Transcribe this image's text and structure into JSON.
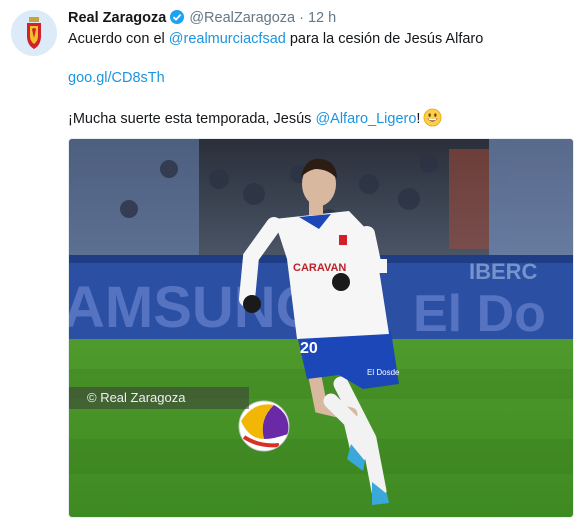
{
  "tweet": {
    "name": "Real Zaragoza",
    "handle": "@RealZaragoza",
    "separator": "·",
    "time": "12 h",
    "line1_prefix": "Acuerdo con el ",
    "line1_mention": "@realmurciacfsad",
    "line1_suffix": " para la cesión de Jesús Alfaro",
    "short_link": "goo.gl/CD8sTh",
    "line3_prefix": "¡Mucha suerte esta temporada, Jesús ",
    "line3_mention": "@Alfaro_Ligero",
    "line3_suffix": "!",
    "icons": {
      "verified": "verified-badge-icon",
      "emoji": "grinning-face-icon",
      "avatar": "real-zaragoza-crest-icon"
    }
  },
  "media": {
    "watermark": "© Real Zaragoza",
    "ad_board": {
      "left": "AMSUNG",
      "right": "El Do",
      "top_right": "IBERC"
    },
    "shirt_sponsor": "CARAVAN",
    "shorts_sponsor": "El Dosde",
    "shorts_number": "20"
  },
  "colors": {
    "link": "#1b95e0",
    "verified": "#1da1f2",
    "secondary_text": "#657786",
    "ad_blue": "#2a4fa3"
  }
}
